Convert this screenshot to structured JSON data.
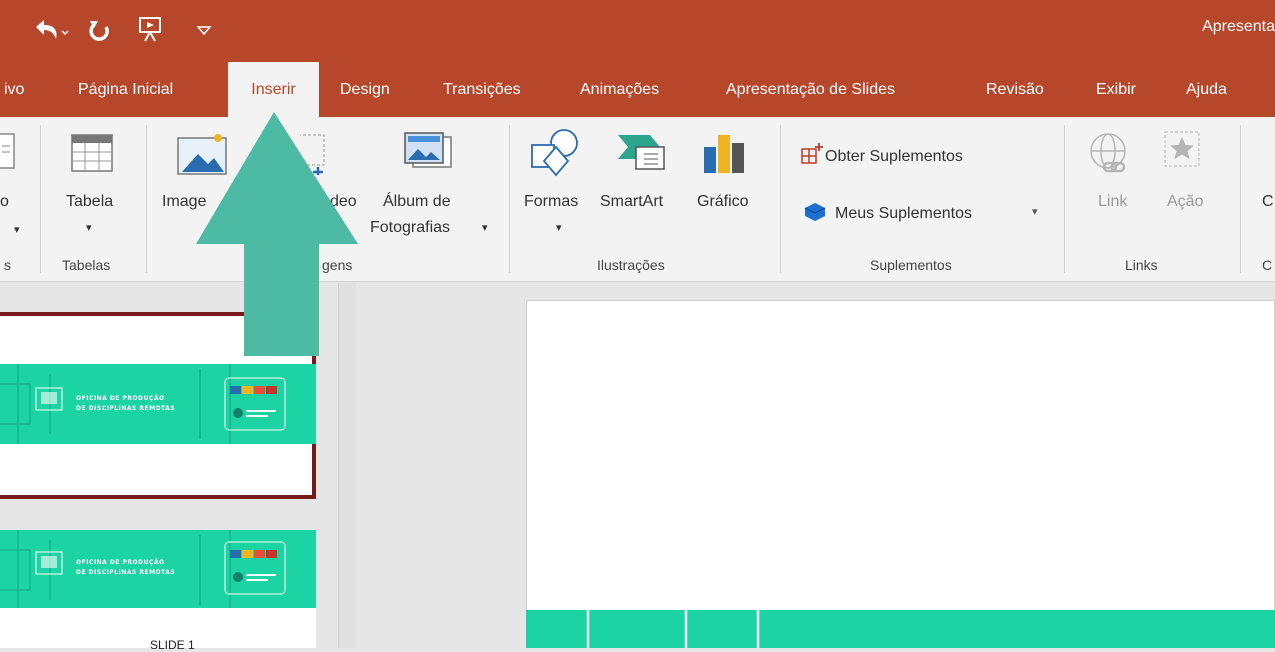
{
  "window": {
    "title": "Apresenta"
  },
  "quick_access": [
    "undo-icon",
    "redo-icon",
    "start-presentation-icon",
    "customize-qat-icon"
  ],
  "tabs": {
    "arquivo": "ivo",
    "pagina_inicial": "Página Inicial",
    "inserir": "Inserir",
    "design": "Design",
    "transicoes": "Transições",
    "animacoes": "Animações",
    "apresentacao": "Apresentação de Slides",
    "revisao": "Revisão",
    "exibir": "Exibir",
    "ajuda": "Ajuda"
  },
  "ribbon": {
    "novo_slide_partial": "o",
    "slides_group_partial": "s",
    "tabela": "Tabela",
    "tabelas_group": "Tabelas",
    "imagens_partial": "Image",
    "video_partial": "deo",
    "album_line1": "Álbum de",
    "album_line2": "Fotografias",
    "imagens_group_partial": "gens",
    "formas": "Formas",
    "smartart": "SmartArt",
    "grafico": "Gráfico",
    "ilustracoes_group": "Ilustrações",
    "obter_suplementos": "Obter Suplementos",
    "meus_suplementos": "Meus Suplementos",
    "suplementos_group": "Suplementos",
    "link": "Link",
    "acao": "Ação",
    "links_group": "Links",
    "comentario_partial": "C",
    "comentarios_group_partial": "C"
  },
  "thumbnails": [
    {
      "line1": "OFICINA DE PRODUÇÃO",
      "line2": "DE DISCIPLINAS REMOTAS"
    },
    {
      "line1": "OFICINA DE PRODUÇÃO",
      "line2": "DE DISCIPLINAS REMOTAS"
    }
  ],
  "slide_label": "SLIDE 1",
  "colors": {
    "accent": "#b7472a",
    "teal": "#1cd3a3",
    "arrow": "#4dbba3",
    "selected_border": "#7a1b1b"
  }
}
